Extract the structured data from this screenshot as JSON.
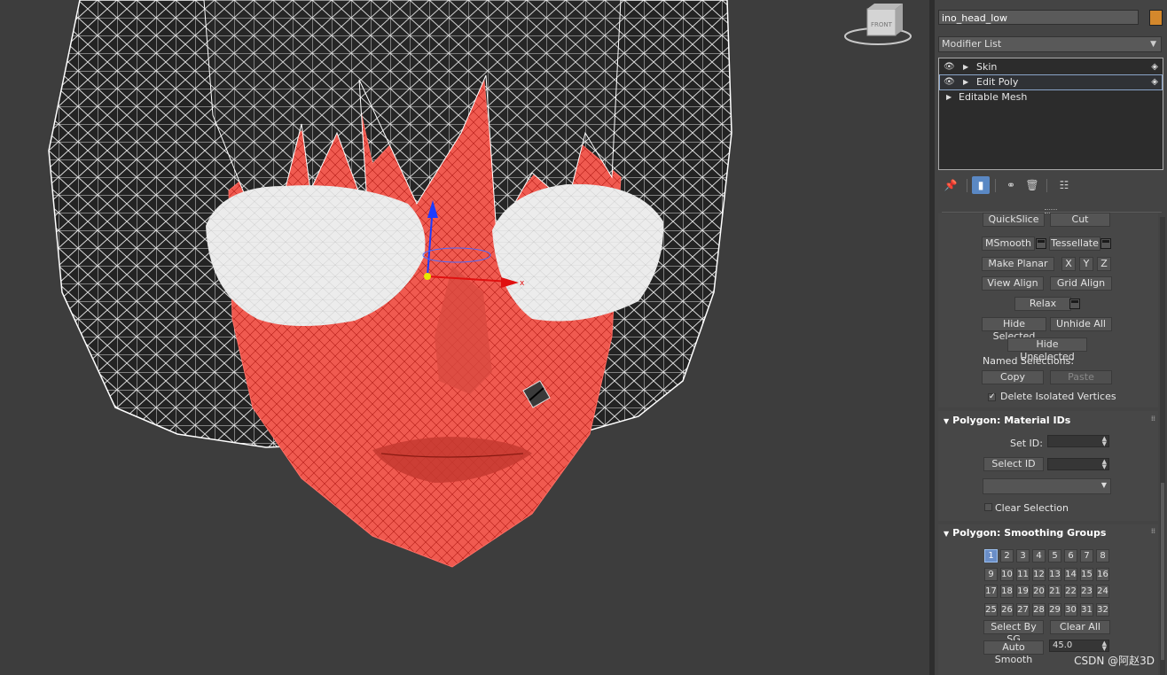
{
  "viewcube": {
    "face_label": "FRONT"
  },
  "command_panel": {
    "object_name": "ino_head_low",
    "object_color": "#d4882c",
    "modifier_list": {
      "label": "Modifier List"
    },
    "stack": [
      {
        "name": "Skin",
        "selected": false
      },
      {
        "name": "Edit Poly",
        "selected": true
      },
      {
        "name": "Editable Mesh",
        "selected": false
      }
    ],
    "geometry": {
      "quickslice": "QuickSlice",
      "cut": "Cut",
      "msmooth": "MSmooth",
      "tessellate": "Tessellate",
      "make_planar": "Make Planar",
      "x": "X",
      "y": "Y",
      "z": "Z",
      "view_align": "View Align",
      "grid_align": "Grid Align",
      "relax": "Relax",
      "hide_selected": "Hide Selected",
      "unhide_all": "Unhide All",
      "hide_unselected": "Hide Unselected",
      "named_selections": "Named Selections:",
      "copy": "Copy",
      "paste": "Paste",
      "delete_isolated": "Delete Isolated Vertices"
    },
    "material_ids": {
      "title": "Polygon: Material IDs",
      "set_id": "Set ID:",
      "select_id": "Select ID",
      "clear_selection": "Clear Selection"
    },
    "smoothing_groups": {
      "title": "Polygon: Smoothing Groups",
      "groups": [
        "1",
        "2",
        "3",
        "4",
        "5",
        "6",
        "7",
        "8",
        "9",
        "10",
        "11",
        "12",
        "13",
        "14",
        "15",
        "16",
        "17",
        "18",
        "19",
        "20",
        "21",
        "22",
        "23",
        "24",
        "25",
        "26",
        "27",
        "28",
        "29",
        "30",
        "31",
        "32"
      ],
      "active_group": "1",
      "select_by_sg": "Select By SG",
      "clear_all": "Clear All",
      "auto_smooth": "Auto Smooth",
      "threshold": "45.0"
    }
  },
  "watermark": "CSDN @阿赵3D",
  "colors": {
    "selection_red": "#f05a50",
    "wire_white": "#ffffff",
    "accent_blue": "#6a8ec8"
  }
}
